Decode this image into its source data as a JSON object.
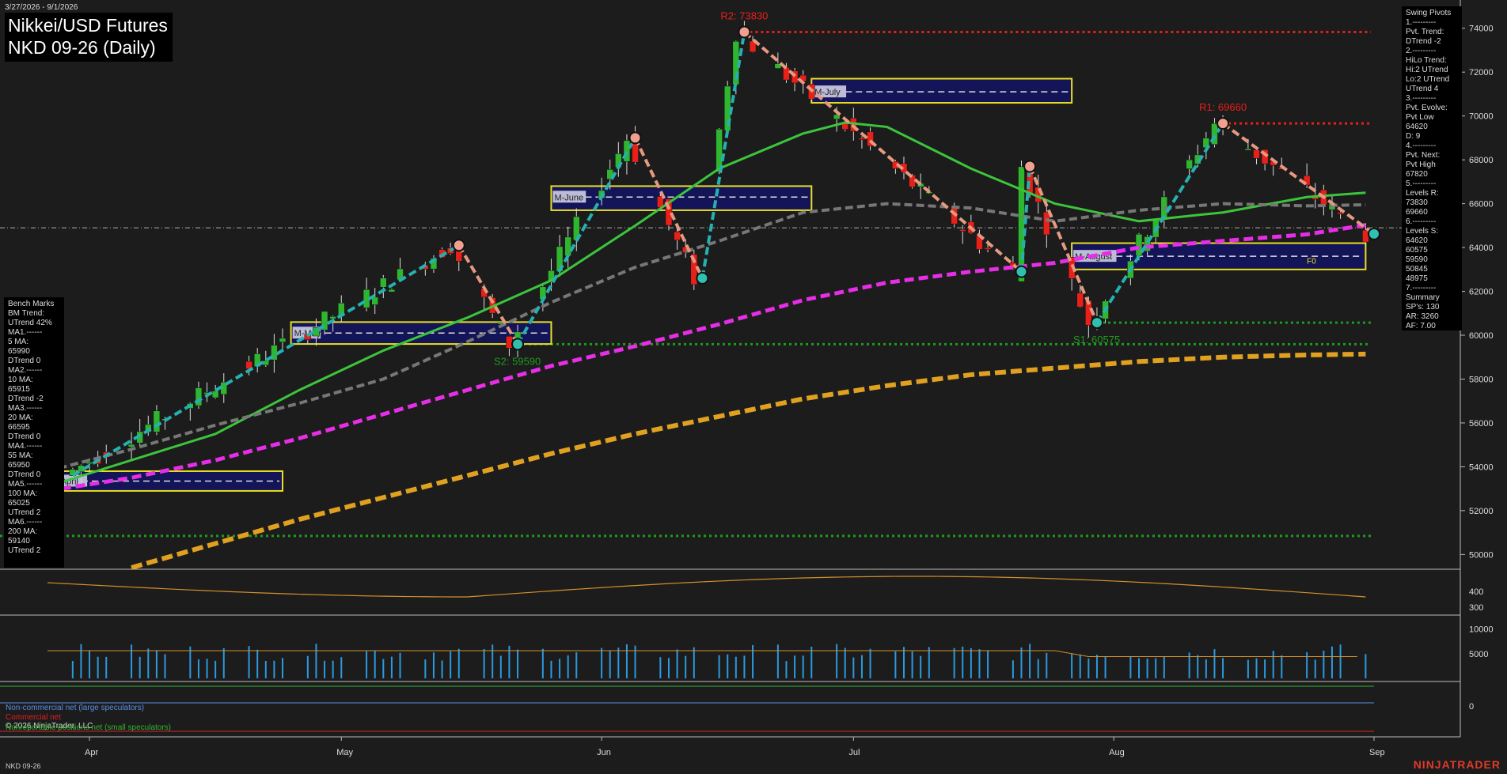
{
  "header": {
    "date_range": "3/27/2026 - 9/1/2026",
    "title_line1": "Nikkei/USD Futures",
    "title_line2": "NKD 09-26 (Daily)"
  },
  "swing_pivots": [
    "Swing Pivots",
    "1.---------",
    "Pvt. Trend:",
    "DTrend -2",
    "2.---------",
    "HiLo Trend:",
    "Hi:2 UTrend",
    "Lo:2 UTrend",
    "UTrend 4",
    "3.---------",
    "Pvt. Evolve:",
    "Pvt Low",
    "64620",
    "D: 9",
    "4.---------",
    "Pvt. Next:",
    "Pvt High",
    "67820",
    "5.---------",
    "Levels R:",
    "73830",
    "69660",
    "6.---------",
    "Levels S:",
    "64620",
    "60575",
    "59590",
    "50845",
    "48975",
    "7.---------",
    "Summary",
    "SP's: 130",
    "AR: 3260",
    "AF: 7.00"
  ],
  "bench_marks": [
    "Bench Marks",
    "BM Trend:",
    "UTrend 42%",
    "MA1.------",
    "5 MA:",
    "65990",
    "DTrend 0",
    "MA2.------",
    "10 MA:",
    "65915",
    "DTrend -2",
    "MA3.------",
    "20 MA:",
    "66595",
    "DTrend 0",
    "MA4.------",
    "55 MA:",
    "65950",
    "DTrend 0",
    "MA5.------",
    "100 MA:",
    "65025",
    "UTrend 2",
    "MA6.------",
    "200 MA:",
    "59140",
    "UTrend 2"
  ],
  "cot": {
    "noncommercial": "Non-commercial net (large speculators)",
    "commercial": "Commercial net",
    "nonreportable": "Nonreportable positions net (small speculators)"
  },
  "copyright": "© 2026 NinjaTrader, LLC",
  "footer_symbol": "NKD 09-26",
  "brand": "NINJATRADER",
  "colors": {
    "up": "#2fb52f",
    "down": "#e8201a",
    "ma20": "#3cc43c",
    "ma55": "#777777",
    "ma100": "#e62ee6",
    "ma200": "#e0a020",
    "zigzag_up": "#26b0b0",
    "zigzag_down": "#e59a80",
    "resist": "#e8201a",
    "support": "#1f9a1f",
    "volume": "#2a9ae0"
  },
  "chart_data": {
    "type": "line",
    "x_ticks": [
      "Apr",
      "May",
      "Jun",
      "Jul",
      "Aug",
      "Sep"
    ],
    "y_ticks": [
      50000,
      52000,
      54000,
      56000,
      58000,
      60000,
      62000,
      64000,
      66000,
      68000,
      70000,
      72000,
      74000
    ],
    "ylim": [
      49400,
      75000
    ],
    "pivot_labels": [
      {
        "text": "R2: 73830",
        "date": "2026-06-18",
        "value": 73830,
        "kind": "high"
      },
      {
        "text": "R1: 69660",
        "date": "2026-08-14",
        "value": 69660,
        "kind": "high"
      },
      {
        "text": "S2: 59590",
        "date": "2026-05-22",
        "value": 59590,
        "kind": "low"
      },
      {
        "text": "S1: 60575",
        "date": "2026-07-30",
        "value": 60575,
        "kind": "low"
      }
    ],
    "resistance_levels": [
      73830,
      69660
    ],
    "support_levels": [
      60575,
      59590,
      50845
    ],
    "last_price_level": 64900,
    "zigzag": [
      {
        "date": "2026-03-30",
        "value": 53600
      },
      {
        "date": "2026-05-15",
        "value": 64100
      },
      {
        "date": "2026-05-22",
        "value": 59590
      },
      {
        "date": "2026-06-05",
        "value": 69000
      },
      {
        "date": "2026-06-13",
        "value": 62600
      },
      {
        "date": "2026-06-18",
        "value": 73830
      },
      {
        "date": "2026-07-21",
        "value": 62900
      },
      {
        "date": "2026-07-22",
        "value": 67700
      },
      {
        "date": "2026-07-30",
        "value": 60575
      },
      {
        "date": "2026-08-14",
        "value": 69660
      },
      {
        "date": "2026-09-01",
        "value": 64620
      }
    ],
    "series": [
      {
        "name": "20 MA",
        "values": [
          [
            0,
            53100
          ],
          [
            10,
            54300
          ],
          [
            20,
            55500
          ],
          [
            30,
            57500
          ],
          [
            40,
            59300
          ],
          [
            50,
            60800
          ],
          [
            60,
            62500
          ],
          [
            70,
            65000
          ],
          [
            80,
            67600
          ],
          [
            90,
            69200
          ],
          [
            95,
            69700
          ],
          [
            100,
            69500
          ],
          [
            110,
            67600
          ],
          [
            120,
            66000
          ],
          [
            130,
            65200
          ],
          [
            140,
            65600
          ],
          [
            150,
            66300
          ],
          [
            157,
            66500
          ]
        ]
      },
      {
        "name": "55 MA",
        "values": [
          [
            0,
            53800
          ],
          [
            10,
            54800
          ],
          [
            20,
            55900
          ],
          [
            30,
            56900
          ],
          [
            40,
            58000
          ],
          [
            50,
            59700
          ],
          [
            60,
            61500
          ],
          [
            70,
            63100
          ],
          [
            80,
            64300
          ],
          [
            90,
            65600
          ],
          [
            100,
            66000
          ],
          [
            110,
            65800
          ],
          [
            120,
            65200
          ],
          [
            130,
            65700
          ],
          [
            140,
            66000
          ],
          [
            150,
            65900
          ],
          [
            157,
            65950
          ]
        ]
      },
      {
        "name": "100 MA",
        "values": [
          [
            0,
            52900
          ],
          [
            10,
            53500
          ],
          [
            20,
            54300
          ],
          [
            30,
            55300
          ],
          [
            40,
            56400
          ],
          [
            50,
            57500
          ],
          [
            60,
            58600
          ],
          [
            70,
            59500
          ],
          [
            80,
            60500
          ],
          [
            90,
            61600
          ],
          [
            100,
            62400
          ],
          [
            110,
            62900
          ],
          [
            120,
            63300
          ],
          [
            130,
            64000
          ],
          [
            140,
            64300
          ],
          [
            150,
            64600
          ],
          [
            157,
            65025
          ]
        ]
      },
      {
        "name": "200 MA",
        "values": [
          [
            10,
            49400
          ],
          [
            20,
            50500
          ],
          [
            30,
            51600
          ],
          [
            40,
            52600
          ],
          [
            50,
            53600
          ],
          [
            60,
            54600
          ],
          [
            70,
            55500
          ],
          [
            80,
            56300
          ],
          [
            90,
            57100
          ],
          [
            100,
            57700
          ],
          [
            110,
            58200
          ],
          [
            120,
            58500
          ],
          [
            130,
            58800
          ],
          [
            140,
            59000
          ],
          [
            150,
            59100
          ],
          [
            157,
            59140
          ]
        ]
      }
    ],
    "monthly_boxes": [
      {
        "label": "M-April",
        "x0": 0,
        "x1": 28,
        "low": 52900,
        "high": 53800,
        "mid": 53350
      },
      {
        "label": "M-May",
        "x0": 29,
        "x1": 60,
        "low": 59600,
        "high": 60600,
        "mid": 60100
      },
      {
        "label": "M-June",
        "x0": 60,
        "x1": 91,
        "low": 65700,
        "high": 66800,
        "mid": 66300
      },
      {
        "label": "M-July",
        "x0": 91,
        "x1": 122,
        "low": 70600,
        "high": 71700,
        "mid": 71100
      },
      {
        "label": "M-August",
        "x0": 122,
        "x1": 157,
        "low": 63000,
        "high": 64200,
        "mid": 63600
      }
    ],
    "fo_label": "F0",
    "volume_panel": {
      "y_ticks": [
        5000,
        10000
      ]
    },
    "atr_panel": {
      "y_ticks": [
        300,
        400
      ]
    },
    "cot_panel": {
      "y_ticks": [
        0
      ]
    }
  }
}
